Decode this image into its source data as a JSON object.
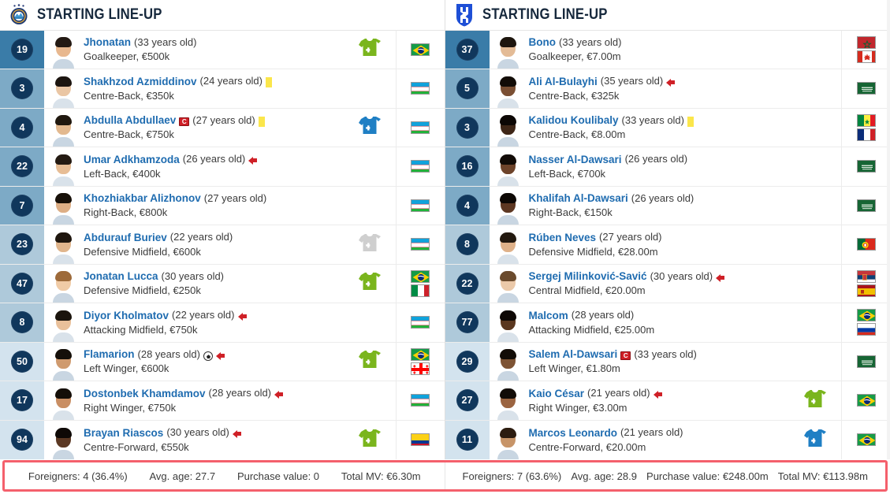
{
  "left": {
    "header": {
      "title": "STARTING LINE-UP",
      "logo_icon": "club-crest-pakhtakor-icon"
    },
    "players": [
      {
        "number": "19",
        "name": "Jhonatan",
        "age": "(33 years old)",
        "position_value": "Goalkeeper, €500k",
        "pos_group": "gk",
        "badges": [],
        "sub_icon": "substituted-in-icon",
        "sub_type": "in",
        "flags": [
          "Brazil"
        ],
        "skin": "#e8b88f",
        "hair": "#241a14"
      },
      {
        "number": "3",
        "name": "Shakhzod Azmiddinov",
        "age": "(24 years old)",
        "position_value": "Centre-Back, €350k",
        "pos_group": "def",
        "badges": [
          "yellow-card"
        ],
        "sub_icon": "",
        "sub_type": "",
        "flags": [
          "Uzbekistan"
        ],
        "skin": "#eac6a4",
        "hair": "#1c1510"
      },
      {
        "number": "4",
        "name": "Abdulla Abdullaev",
        "age": "(27 years old)",
        "position_value": "Centre-Back, €750k",
        "pos_group": "def",
        "badges": [
          "captain",
          "yellow-card"
        ],
        "sub_icon": "substituted-out-icon",
        "sub_type": "out",
        "flags": [
          "Uzbekistan"
        ],
        "skin": "#e3b98f",
        "hair": "#20180f"
      },
      {
        "number": "22",
        "name": "Umar Adkhamzoda",
        "age": "(26 years old)",
        "position_value": "Left-Back, €400k",
        "pos_group": "def",
        "badges": [
          "arrow-out"
        ],
        "sub_icon": "",
        "sub_type": "",
        "flags": [
          "Uzbekistan"
        ],
        "skin": "#e7bd95",
        "hair": "#241a12"
      },
      {
        "number": "7",
        "name": "Khozhiakbar Alizhonov",
        "age": "(27 years old)",
        "position_value": "Right-Back, €800k",
        "pos_group": "def",
        "badges": [],
        "sub_icon": "",
        "sub_type": "",
        "flags": [
          "Uzbekistan"
        ],
        "skin": "#ddae85",
        "hair": "#171009"
      },
      {
        "number": "23",
        "name": "Abdurauf Buriev",
        "age": "(22 years old)",
        "position_value": "Defensive Midfield, €600k",
        "pos_group": "mid",
        "badges": [],
        "sub_icon": "substitute-grey-icon",
        "sub_type": "grey",
        "flags": [
          "Uzbekistan"
        ],
        "skin": "#e0b58c",
        "hair": "#1e160e"
      },
      {
        "number": "47",
        "name": "Jonatan Lucca",
        "age": "(30 years old)",
        "position_value": "Defensive Midfield, €250k",
        "pos_group": "mid",
        "badges": [],
        "sub_icon": "substituted-in-icon",
        "sub_type": "in",
        "flags": [
          "Brazil",
          "Italy"
        ],
        "skin": "#f0cba6",
        "hair": "#9d6a3a"
      },
      {
        "number": "8",
        "name": "Diyor Kholmatov",
        "age": "(22 years old)",
        "position_value": "Attacking Midfield, €750k",
        "pos_group": "mid",
        "badges": [
          "arrow-out"
        ],
        "sub_icon": "",
        "sub_type": "",
        "flags": [
          "Uzbekistan"
        ],
        "skin": "#e9c09a",
        "hair": "#1b140d"
      },
      {
        "number": "50",
        "name": "Flamarion",
        "age": "(28 years old)",
        "position_value": "Left Winger, €600k",
        "pos_group": "fwd",
        "badges": [
          "goal",
          "arrow-out"
        ],
        "sub_icon": "substituted-in-icon",
        "sub_type": "in",
        "flags": [
          "Brazil",
          "Georgia"
        ],
        "skin": "#cf9a6e",
        "hair": "#15100a"
      },
      {
        "number": "17",
        "name": "Dostonbek Khamdamov",
        "age": "(28 years old)",
        "position_value": "Right Winger, €750k",
        "pos_group": "fwd",
        "badges": [
          "arrow-out"
        ],
        "sub_icon": "",
        "sub_type": "",
        "flags": [
          "Uzbekistan"
        ],
        "skin": "#c98e63",
        "hair": "#140e08"
      },
      {
        "number": "94",
        "name": "Brayan Riascos",
        "age": "(30 years old)",
        "position_value": "Centre-Forward, €550k",
        "pos_group": "fwd",
        "badges": [
          "arrow-out"
        ],
        "sub_icon": "substituted-in-icon",
        "sub_type": "in",
        "flags": [
          "Colombia"
        ],
        "skin": "#5b3823",
        "hair": "#0e0906"
      }
    ],
    "footer": [
      "Foreigners: 4 (36.4%)",
      "Avg. age: 27.7",
      "Purchase value: 0",
      "Total MV: €6.30m"
    ]
  },
  "right": {
    "header": {
      "title": "STARTING LINE-UP",
      "logo_icon": "club-crest-alhilal-icon"
    },
    "players": [
      {
        "number": "37",
        "name": "Bono",
        "age": "(33 years old)",
        "position_value": "Goalkeeper, €7.00m",
        "pos_group": "gk",
        "badges": [],
        "sub_icon": "",
        "sub_type": "",
        "flags": [
          "Morocco",
          "Canada"
        ],
        "skin": "#e3bb96",
        "hair": "#1d150e"
      },
      {
        "number": "5",
        "name": "Ali Al-Bulayhi",
        "age": "(35 years old)",
        "position_value": "Centre-Back, €325k",
        "pos_group": "def",
        "badges": [
          "arrow-out"
        ],
        "sub_icon": "",
        "sub_type": "",
        "flags": [
          "Saudi Arabia"
        ],
        "skin": "#7a4f33",
        "hair": "#120c07"
      },
      {
        "number": "3",
        "name": "Kalidou Koulibaly",
        "age": "(33 years old)",
        "position_value": "Centre-Back, €8.00m",
        "pos_group": "def",
        "badges": [
          "yellow-card"
        ],
        "sub_icon": "",
        "sub_type": "",
        "flags": [
          "Senegal",
          "France"
        ],
        "skin": "#3e2617",
        "hair": "#0c0705"
      },
      {
        "number": "16",
        "name": "Nasser Al-Dawsari",
        "age": "(26 years old)",
        "position_value": "Left-Back, €700k",
        "pos_group": "def",
        "badges": [],
        "sub_icon": "",
        "sub_type": "",
        "flags": [
          "Saudi Arabia"
        ],
        "skin": "#6d432a",
        "hair": "#110b07"
      },
      {
        "number": "4",
        "name": "Khalifah Al-Dawsari",
        "age": "(26 years old)",
        "position_value": "Right-Back, €150k",
        "pos_group": "def",
        "badges": [],
        "sub_icon": "",
        "sub_type": "",
        "flags": [
          "Saudi Arabia"
        ],
        "skin": "#5d3722",
        "hair": "#0d0805"
      },
      {
        "number": "8",
        "name": "Rúben Neves",
        "age": "(27 years old)",
        "position_value": "Defensive Midfield, €28.00m",
        "pos_group": "mid",
        "badges": [],
        "sub_icon": "",
        "sub_type": "",
        "flags": [
          "Portugal"
        ],
        "skin": "#dfb189",
        "hair": "#23190f"
      },
      {
        "number": "22",
        "name": "Sergej Milinković-Savić",
        "age": "(30 years old)",
        "position_value": "Central Midfield, €20.00m",
        "pos_group": "mid",
        "badges": [
          "arrow-out"
        ],
        "sub_icon": "",
        "sub_type": "",
        "flags": [
          "Serbia",
          "Spain"
        ],
        "skin": "#ebc9a9",
        "hair": "#6a4a2d"
      },
      {
        "number": "77",
        "name": "Malcom",
        "age": "(28 years old)",
        "position_value": "Attacking Midfield, €25.00m",
        "pos_group": "mid",
        "badges": [],
        "sub_icon": "",
        "sub_type": "",
        "flags": [
          "Brazil",
          "Russia"
        ],
        "skin": "#5a371f",
        "hair": "#0e0805"
      },
      {
        "number": "29",
        "name": "Salem Al-Dawsari",
        "age": "(33 years old)",
        "position_value": "Left Winger, €1.80m",
        "pos_group": "fwd",
        "badges": [
          "captain"
        ],
        "sub_icon": "",
        "sub_type": "",
        "flags": [
          "Saudi Arabia"
        ],
        "skin": "#7d5334",
        "hair": "#120c07"
      },
      {
        "number": "27",
        "name": "Kaio César",
        "age": "(21 years old)",
        "position_value": "Right Winger, €3.00m",
        "pos_group": "fwd",
        "badges": [
          "arrow-out"
        ],
        "sub_icon": "substituted-in-icon",
        "sub_type": "in",
        "flags": [
          "Brazil"
        ],
        "skin": "#9b6440",
        "hair": "#120c07"
      },
      {
        "number": "11",
        "name": "Marcos Leonardo",
        "age": "(21 years old)",
        "position_value": "Centre-Forward, €20.00m",
        "pos_group": "fwd",
        "badges": [],
        "sub_icon": "substituted-out-icon",
        "sub_type": "out",
        "flags": [
          "Brazil"
        ],
        "skin": "#c79468",
        "hair": "#2c1c10"
      }
    ],
    "footer": [
      "Foreigners: 7 (63.6%)",
      "Avg. age: 28.9",
      "Purchase value: €248.00m",
      "Total MV: €113.98m"
    ]
  },
  "colors": {
    "num_gk": "#3a7ca8",
    "num_def": "#7daac6",
    "num_mid": "#aec9da",
    "num_fwd": "#d3e3ee",
    "badge_navy": "#10375c",
    "name_link": "#1f6cb0",
    "sub_in_green": "#7ab51d",
    "sub_out_blue": "#1f7fc4",
    "sub_grey": "#cfcfcf",
    "footer_border": "#f4606c",
    "yellow_card": "#fbe64b",
    "captain_red": "#cf2027"
  }
}
